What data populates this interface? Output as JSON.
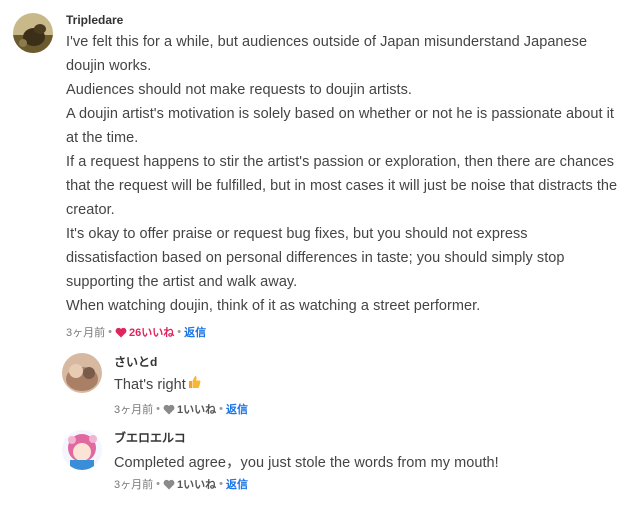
{
  "comments": [
    {
      "author": "Tripledare",
      "lines": [
        "I've felt this for a while, but audiences outside of Japan misunderstand Japanese",
        "doujin works.",
        "Audiences should not make requests to doujin artists.",
        "A doujin artist's motivation is solely based on whether or not he is passionate about it",
        "at the time.",
        "If a request happens to stir the artist's passion or exploration, then there are chances",
        "that the request will be fulfilled, but in most cases it will just be noise that distracts the",
        "creator.",
        "It's okay to offer praise or request bug fixes, but you should not express",
        "dissatisfaction based on personal differences in taste; you should simply stop",
        "supporting the artist and walk away.",
        "When watching doujin, think of it as watching a street performer."
      ],
      "time": "3ヶ月前",
      "likes": "26いいね",
      "reply": "返信",
      "liked": true,
      "heart_color": "#e0245e"
    },
    {
      "author": "さいとd",
      "text": "That's right",
      "emoji": "thumbs-up-icon",
      "time": "3ヶ月前",
      "likes": "1いいね",
      "reply": "返信",
      "liked": false,
      "heart_color": "#8a8a8a"
    },
    {
      "author": "ブエロエルコ",
      "text": "Completed agree，you just stole the words from my mouth!",
      "time": "3ヶ月前",
      "likes": "1いいね",
      "reply": "返信",
      "liked": false,
      "heart_color": "#8a8a8a"
    }
  ],
  "colors": {
    "accent": "#1a73e8",
    "like": "#e0245e"
  }
}
